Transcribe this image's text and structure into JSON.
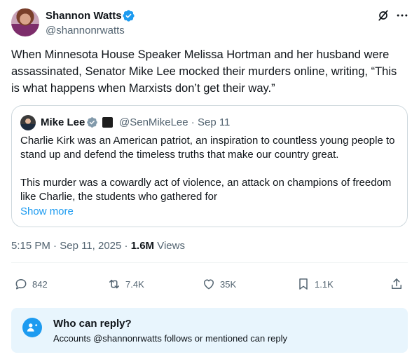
{
  "tweet": {
    "author_name": "Shannon Watts",
    "author_handle": "@shannonrwatts",
    "text": "When Minnesota House Speaker Melissa Hortman and her husband were assassinated, Senator Mike Lee mocked their murders online, writing, “This is what happens when Marxists don’t get their way.”",
    "time": "5:15 PM",
    "date": "Sep 11, 2025",
    "separator": "·",
    "views_count": "1.6M",
    "views_label": "Views"
  },
  "quote": {
    "author_name": "Mike Lee",
    "author_handle": "@SenMikeLee",
    "date": "Sep 11",
    "paragraphs": [
      "Charlie Kirk was an American patriot, an inspiration to countless young people to stand up and defend the timeless truths that make our country great.",
      "This murder was a cowardly act of  violence, an attack on champions of freedom like Charlie, the students who gathered for"
    ],
    "show_more": "Show more"
  },
  "actions": {
    "replies": "842",
    "reposts": "7.4K",
    "likes": "35K",
    "bookmarks": "1.1K"
  },
  "reply_restriction": {
    "title": "Who can reply?",
    "subtitle": "Accounts @shannonrwatts follows or mentioned can reply"
  },
  "icons": {
    "verified": "verified-badge-icon",
    "grok": "grok-icon",
    "more": "more-icon",
    "reply": "reply-icon",
    "repost": "repost-icon",
    "like": "like-icon",
    "bookmark": "bookmark-icon",
    "share": "share-icon",
    "mention": "mention-icon"
  },
  "colors": {
    "accent": "#1d9bf0",
    "text": "#0f1419",
    "secondary": "#536471",
    "reply_box_bg": "#e8f5fd"
  }
}
